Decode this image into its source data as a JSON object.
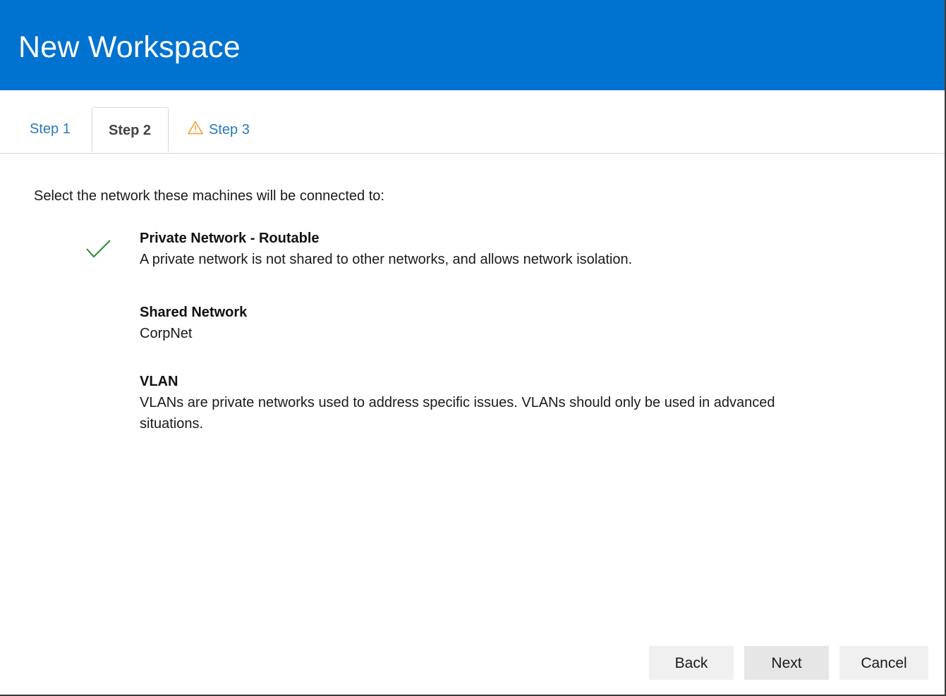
{
  "window": {
    "title": "New Workspace"
  },
  "tabs": [
    {
      "label": "Step 1",
      "state": "normal"
    },
    {
      "label": "Step 2",
      "state": "selected"
    },
    {
      "label": "Step 3",
      "state": "warning",
      "icon": "warning-triangle-icon"
    }
  ],
  "main": {
    "prompt": "Select the network these machines will be connected to:",
    "options": [
      {
        "title": "Private Network - Routable",
        "description": "A private network is not shared to other networks, and allows network isolation.",
        "selected": true
      },
      {
        "title": "Shared Network",
        "description": "CorpNet",
        "selected": false
      },
      {
        "title": "VLAN",
        "description": "VLANs are private networks used to address specific issues. VLANs should only be used in advanced situations.",
        "selected": false
      }
    ]
  },
  "footer": {
    "back_label": "Back",
    "next_label": "Next",
    "cancel_label": "Cancel"
  },
  "colors": {
    "header_bg": "#0072cf",
    "tab_link": "#2a7ab8",
    "warning": "#f0a030",
    "check": "#2e8b2e"
  }
}
